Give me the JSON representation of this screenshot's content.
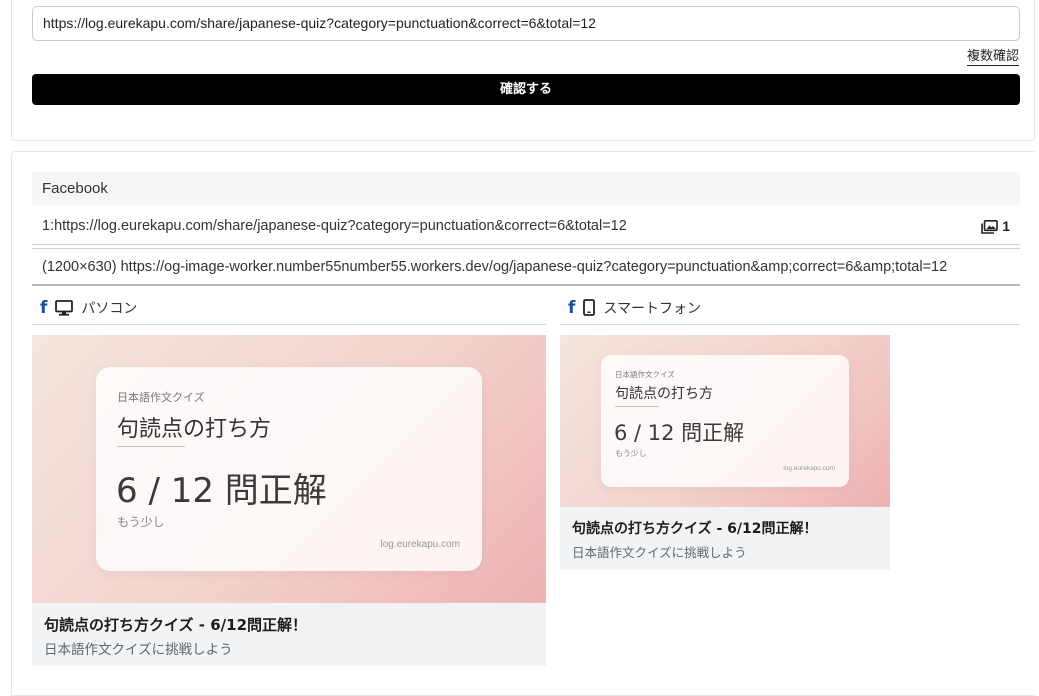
{
  "form": {
    "url_value": "https://log.eurekapu.com/share/japanese-quiz?category=punctuation&correct=6&total=12",
    "multi_confirm_label": "複数確認",
    "confirm_button_label": "確認する"
  },
  "facebook": {
    "section_title": "Facebook",
    "url_row": "1:https://log.eurekapu.com/share/japanese-quiz?category=punctuation&correct=6&total=12",
    "image_count": "1",
    "image_row": "(1200×630) https://og-image-worker.number55number55.workers.dev/og/japanese-quiz?category=punctuation&amp;correct=6&amp;total=12",
    "desktop_label": "パソコン",
    "mobile_label": "スマートフォン",
    "og": {
      "category": "日本語作文クイズ",
      "title": "句読点の打ち方",
      "score": "6 / 12 問正解",
      "sub": "もう少し",
      "domain": "log.eurekapu.com"
    },
    "caption_title": "句読点の打ち方クイズ - 6/12問正解！",
    "caption_desc": "日本語作文クイズに挑戦しよう"
  },
  "colors": {
    "facebook_blue": "#1a4fa0",
    "button_black": "#000000",
    "caption_bg": "#f2f3f5"
  },
  "icons": {
    "facebook": "facebook-icon",
    "desktop": "monitor-icon",
    "mobile": "smartphone-icon",
    "images": "images-icon"
  }
}
